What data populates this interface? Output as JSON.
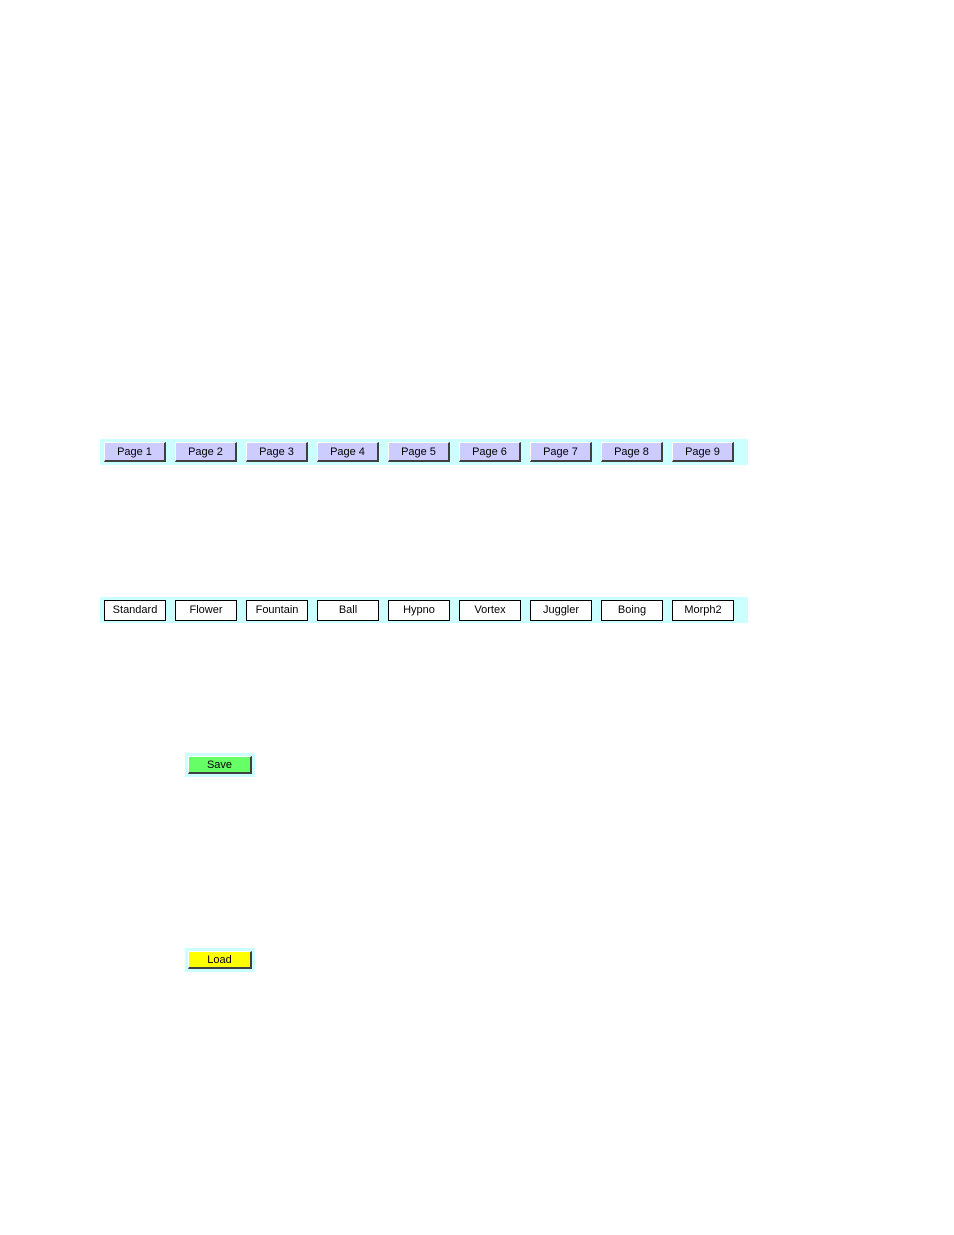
{
  "colors": {
    "page_background": "#ffffff",
    "strip_background": "#ccffff",
    "page_button_fill": "#ccccff",
    "effect_button_fill": "#ffffff",
    "save_button_fill": "#66ff66",
    "load_button_fill": "#ffff00",
    "bevel_highlight": "#ffffff",
    "bevel_shadow": "#404040",
    "text": "#000000"
  },
  "page_selector": {
    "buttons": [
      {
        "label": "Page 1"
      },
      {
        "label": "Page 2"
      },
      {
        "label": "Page 3"
      },
      {
        "label": "Page 4"
      },
      {
        "label": "Page 5"
      },
      {
        "label": "Page 6"
      },
      {
        "label": "Page 7"
      },
      {
        "label": "Page 8"
      },
      {
        "label": "Page 9"
      }
    ]
  },
  "effect_selector": {
    "buttons": [
      {
        "label": "Standard"
      },
      {
        "label": "Flower"
      },
      {
        "label": "Fountain"
      },
      {
        "label": "Ball"
      },
      {
        "label": "Hypno"
      },
      {
        "label": "Vortex"
      },
      {
        "label": "Juggler"
      },
      {
        "label": "Boing"
      },
      {
        "label": "Morph2"
      }
    ]
  },
  "actions": {
    "save": {
      "label": "Save"
    },
    "load": {
      "label": "Load"
    }
  }
}
